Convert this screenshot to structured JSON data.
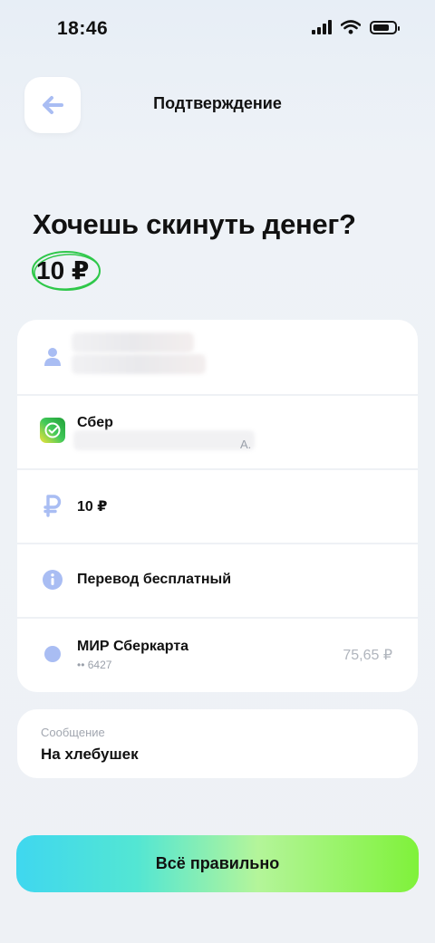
{
  "status_bar": {
    "time": "18:46"
  },
  "header": {
    "title": "Подтверждение"
  },
  "question": "Хочешь скинуть денег?",
  "amount": "10 ₽",
  "rows": {
    "bank_name": "Сбер",
    "bank_suffix": "А.",
    "amount": "10 ₽",
    "fee": "Перевод бесплатный",
    "card_name": "МИР Сберкарта",
    "card_number": "•• 6427",
    "card_balance": "75,65 ₽"
  },
  "message": {
    "label": "Сообщение",
    "value": "На хлебушек"
  },
  "confirm_button": "Всё правильно",
  "colors": {
    "icon_accent": "#a9bdf3",
    "button_gradient_start": "#3fd7ef",
    "button_gradient_end": "#7ff23a",
    "circle_highlight": "#2fc84a",
    "bank_logo": "#21a038"
  }
}
